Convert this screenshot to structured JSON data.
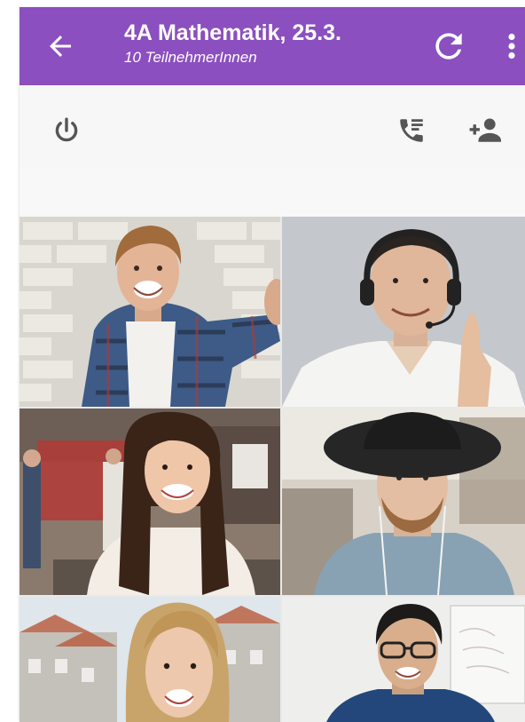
{
  "appbar": {
    "title": "4A Mathematik, 25.3.",
    "subtitle": "10 TeilnehmerInnen",
    "back_icon": "arrow-back-icon",
    "refresh_icon": "refresh-icon",
    "more_icon": "more-vert-icon"
  },
  "toolbar": {
    "icons": [
      "power-icon",
      "call-list-icon",
      "add-person-icon"
    ]
  },
  "participants": [
    {
      "tile": "participant-1",
      "photo": "young man with curly hair in plaid shirt"
    },
    {
      "tile": "participant-2",
      "photo": "man with headset"
    },
    {
      "tile": "participant-3",
      "photo": "woman with long dark hair in office"
    },
    {
      "tile": "participant-4",
      "photo": "man with hat and beard"
    },
    {
      "tile": "participant-5",
      "photo": "blonde woman outdoors"
    },
    {
      "tile": "participant-6",
      "photo": "young man with glasses"
    }
  ],
  "colors": {
    "appbar": "#8b4fbf",
    "appbar_text": "#ffffff",
    "toolbar_bg": "#f7f7f7",
    "icon_gray": "#555555"
  }
}
